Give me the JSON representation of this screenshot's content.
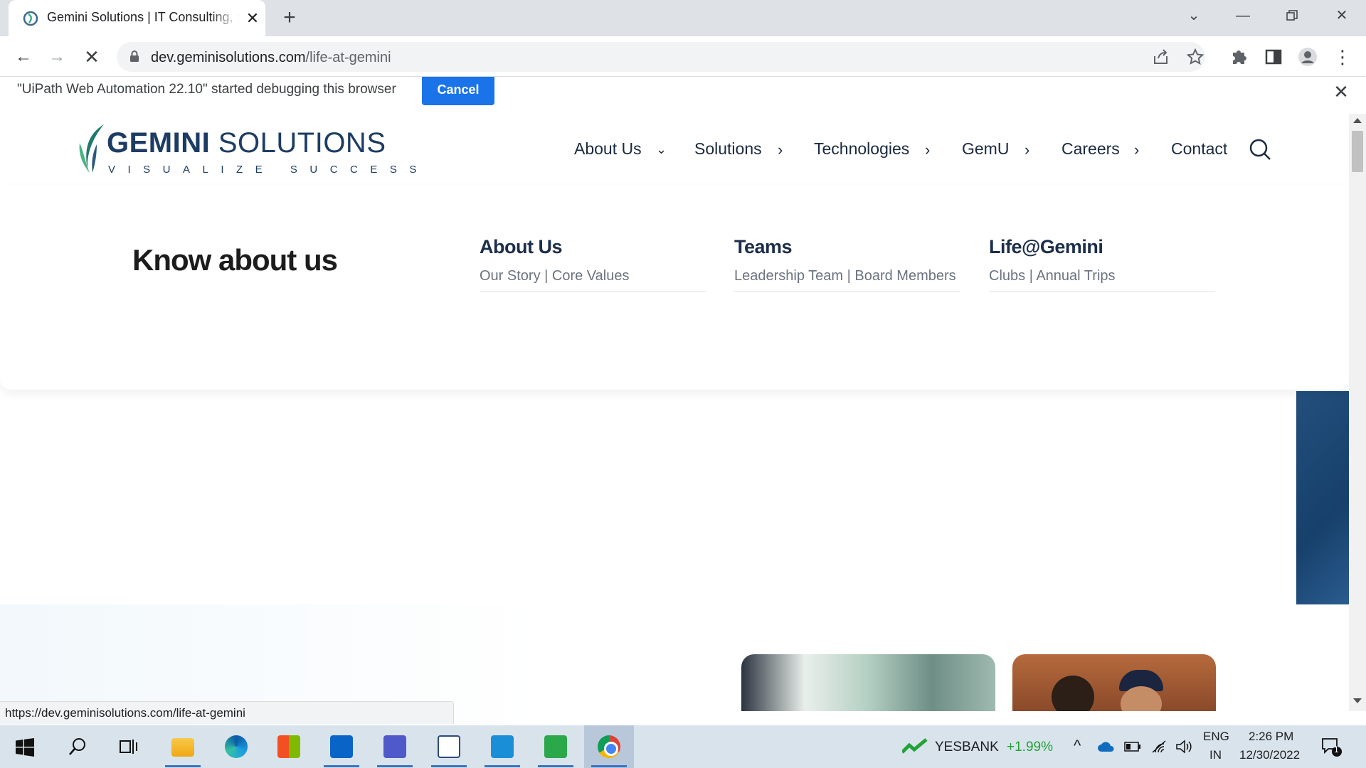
{
  "browser": {
    "tab_title": "Gemini Solutions | IT Consulting, Software Development",
    "url_host": "dev.geminisolutions.com",
    "url_path": "/life-at-gemini"
  },
  "infobar": {
    "message": "\"UiPath Web Automation 22.10\" started debugging this browser",
    "cancel_label": "Cancel"
  },
  "site": {
    "logo_name_bold": "GEMINI",
    "logo_name_rest": " SOLUTIONS",
    "logo_tagline": "VISUALIZE SUCCESS",
    "nav": [
      "About Us",
      "Solutions",
      "Technologies",
      "GemU",
      "Careers",
      "Contact"
    ],
    "mega_heading": "Know about us",
    "columns": [
      {
        "title": "About Us",
        "sub": "Our Story | Core Values"
      },
      {
        "title": "Teams",
        "sub": "Leadership Team | Board Members"
      },
      {
        "title": "Life@Gemini",
        "sub": "Clubs | Annual Trips"
      }
    ]
  },
  "status_url": "https://dev.geminisolutions.com/life-at-gemini",
  "taskbar": {
    "stock_name": "YESBANK",
    "stock_change": "+1.99%",
    "lang_top": "ENG",
    "lang_bottom": "IN",
    "time": "2:26 PM",
    "date": "12/30/2022",
    "notif_count": "1"
  },
  "colors": {
    "chrome_blue": "#1a73e8",
    "brand_navy": "#1d3c63",
    "stock_green": "#21a336"
  }
}
